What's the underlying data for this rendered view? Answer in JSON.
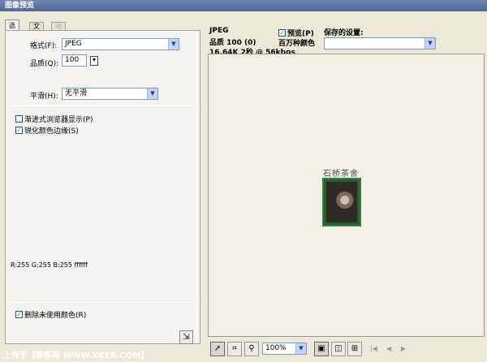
{
  "window": {
    "title": "图像预览"
  },
  "tabs": [
    {
      "label": "选项"
    },
    {
      "label": "文件"
    },
    {
      "label": "动画"
    }
  ],
  "options": {
    "format_label": "格式(F):",
    "format_value": "JPEG",
    "quality_label": "品质(Q):",
    "quality_value": "100",
    "smoothing_label": "平滑(H):",
    "smoothing_value": "无平滑",
    "progressive_label": "渐进式浏览器显示(P)",
    "progressive_checked": false,
    "sharpen_label": "锐化颜色边缘(S)",
    "sharpen_checked": true,
    "color_readout": "R:255 G:255 B:255 ffffff",
    "remove_unused_label": "删除未使用颜色(R)",
    "remove_unused_checked": true
  },
  "preview_info": {
    "format": "JPEG",
    "quality": "品质 100 (0)",
    "size": "16.64K  2秒 @ 56kbps",
    "preview_label": "预览(P)",
    "preview_checked": true,
    "colors": "百万种颜色",
    "saved_settings_label": "保存的设置:",
    "saved_settings_value": ""
  },
  "preview": {
    "image_caption": "石桥茶舍"
  },
  "toolbar": {
    "zoom_value": "100%",
    "pointer_icon": "pointer-icon",
    "crop_icon": "crop-icon",
    "zoom_icon": "magnifier-icon"
  },
  "footer": {
    "text": "上传于【新客网 WWW.XKER.COM】"
  }
}
